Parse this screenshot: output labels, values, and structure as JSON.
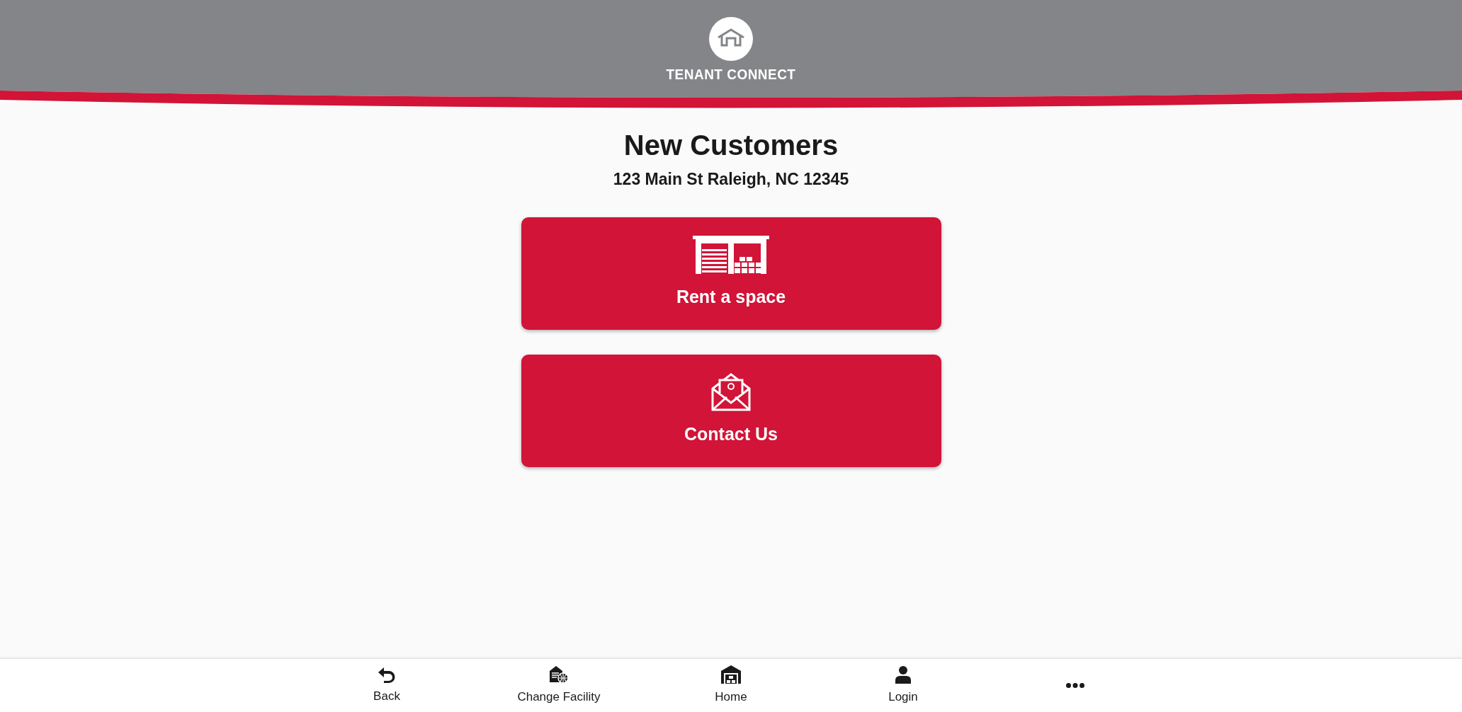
{
  "header": {
    "brand": "TENANT CONNECT"
  },
  "title": "New Customers",
  "address": "123 Main St Raleigh, NC 12345",
  "actions": [
    {
      "label": "Rent a space",
      "kind": "storage"
    },
    {
      "label": "Contact Us",
      "kind": "mail"
    }
  ],
  "nav": [
    {
      "label": "Back",
      "kind": "back"
    },
    {
      "label": "Change Facility",
      "kind": "facility"
    },
    {
      "label": "Home",
      "kind": "home"
    },
    {
      "label": "Login",
      "kind": "user"
    },
    {
      "kind": "more"
    }
  ]
}
